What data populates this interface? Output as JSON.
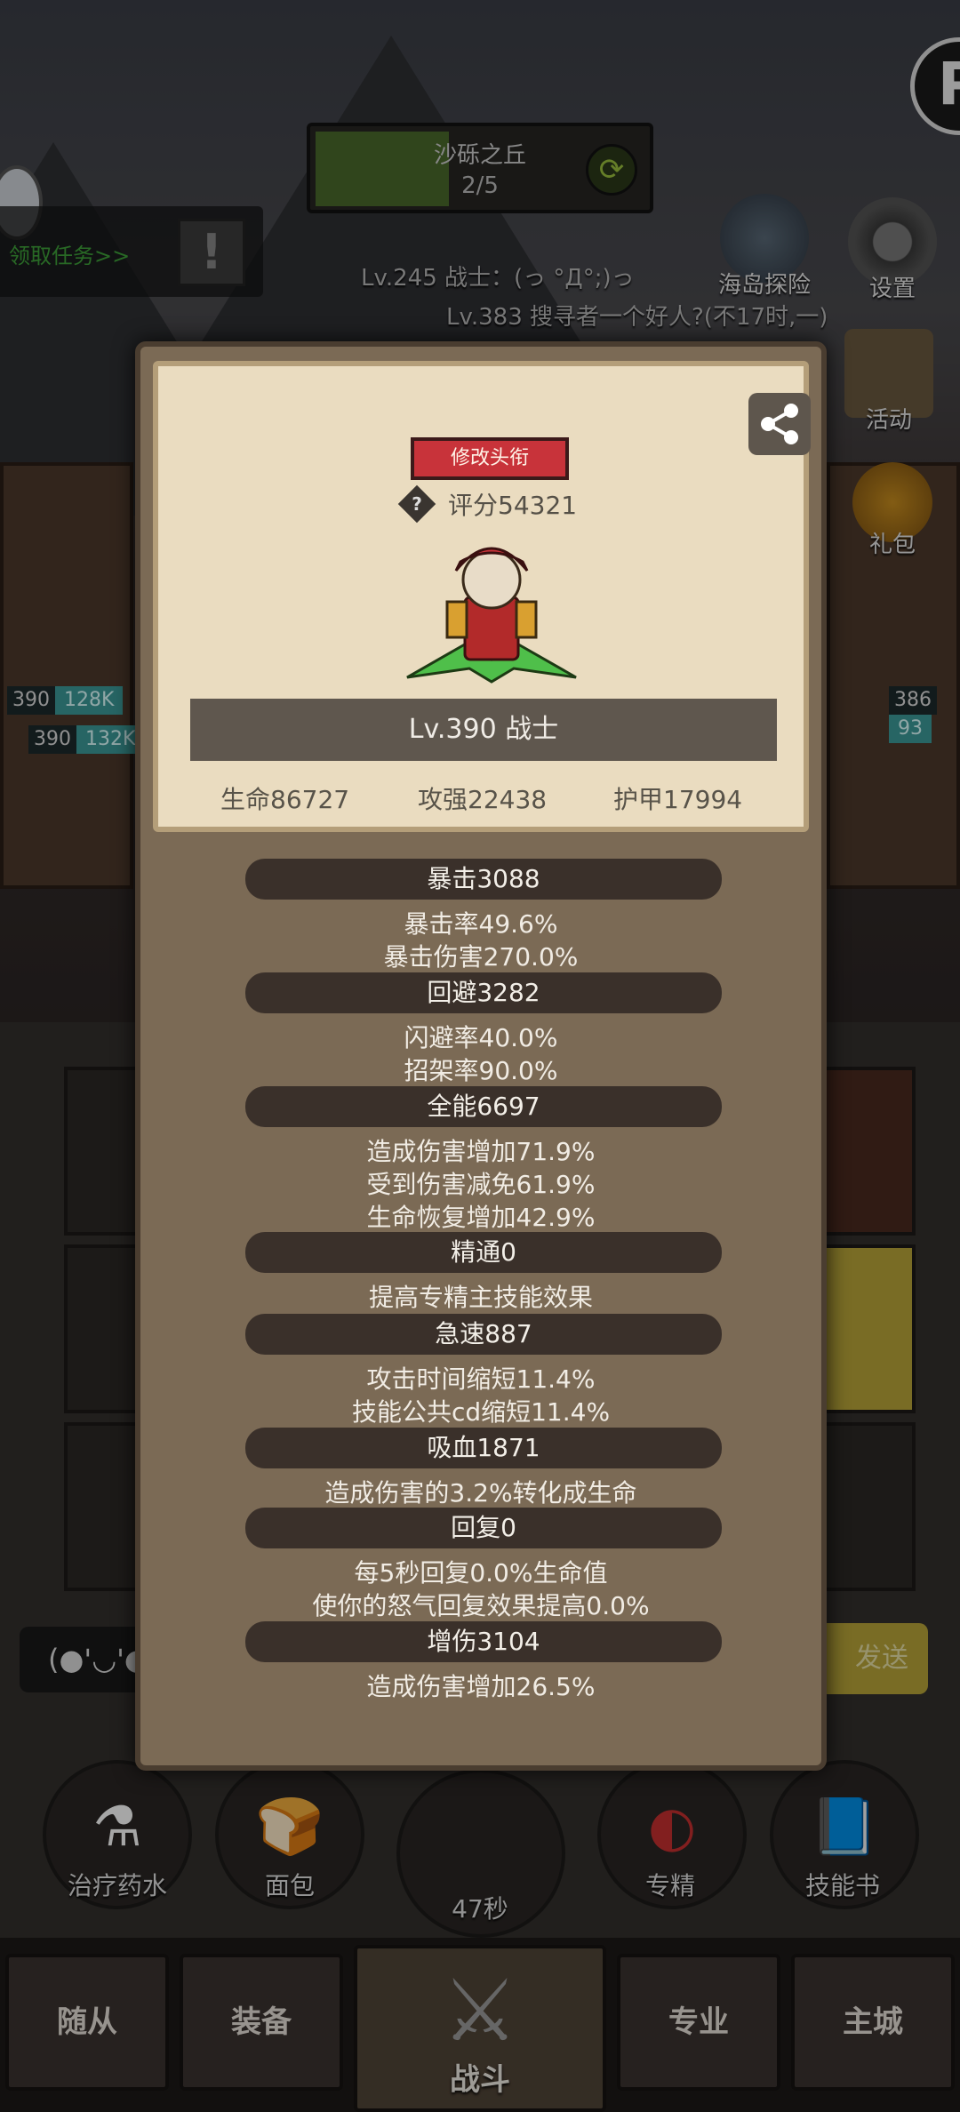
{
  "stage": {
    "title": "沙砾之丘",
    "count": "2/5"
  },
  "quest": {
    "label": "领取任务>>"
  },
  "side_menu": {
    "explore": "海岛探险",
    "settings": "设置",
    "activity": "活动",
    "gift": "礼包"
  },
  "battle_log": [
    "Lv.245 战士：(っ °Д°;)っ",
    "Lv.383 搜寻者一个好人?(不17时,一)"
  ],
  "hp_tags": {
    "left1": {
      "lv": "390",
      "val": "128K"
    },
    "left2": {
      "lv": "390",
      "val": "132K"
    },
    "right1": {
      "lv": "386",
      "val": "93"
    }
  },
  "popup": {
    "title_button": "修改头衔",
    "help": "?",
    "score": "评分54321",
    "level_class": "Lv.390 战士",
    "hp": "生命86727",
    "attack": "攻强22438",
    "armor": "护甲17994",
    "attributes": [
      {
        "name": "暴击3088",
        "lines": [
          "暴击率49.6%",
          "暴击伤害270.0%"
        ]
      },
      {
        "name": "回避3282",
        "lines": [
          "闪避率40.0%",
          "招架率90.0%"
        ]
      },
      {
        "name": "全能6697",
        "lines": [
          "造成伤害增加71.9%",
          "受到伤害减免61.9%",
          "生命恢复增加42.9%"
        ]
      },
      {
        "name": "精通0",
        "lines": [
          "提高专精主技能效果"
        ]
      },
      {
        "name": "急速887",
        "lines": [
          "攻击时间缩短11.4%",
          "技能公共cd缩短11.4%"
        ]
      },
      {
        "name": "吸血1871",
        "lines": [
          "造成伤害的3.2%转化成生命"
        ]
      },
      {
        "name": "回复0",
        "lines": [
          "每5秒回复0.0%生命值",
          "使你的怒气回复效果提高0.0%"
        ]
      },
      {
        "name": "增伤3104",
        "lines": [
          "造成伤害增加26.5%"
        ]
      }
    ]
  },
  "chat": {
    "emoji": "(●'◡'●",
    "send": "发送"
  },
  "items": {
    "potion": "治疗药水",
    "bread": "面包",
    "timer": "47秒",
    "spec": "专精",
    "skillbook": "技能书"
  },
  "nav": {
    "follower": "随从",
    "equipment": "装备",
    "battle": "战斗",
    "profession": "专业",
    "city": "主城"
  },
  "colors": {
    "accent_red": "#c8333a",
    "parchment": "#eadcc0",
    "panel": "#7b6a55",
    "stat_bar": "#3a302a"
  }
}
